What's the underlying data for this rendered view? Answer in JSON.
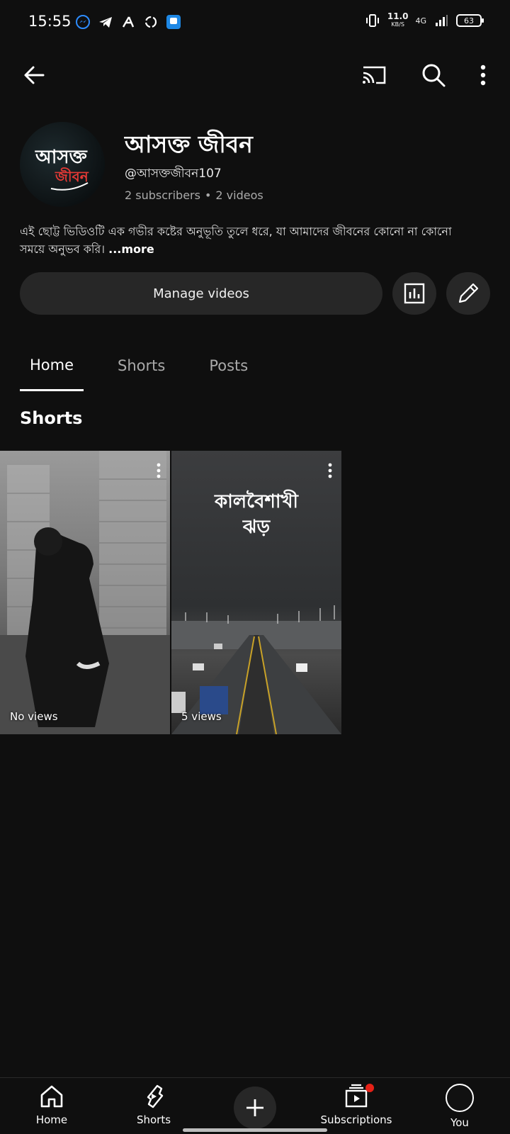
{
  "status_bar": {
    "time": "15:55",
    "speed_value": "11.0",
    "speed_unit": "KB/S",
    "network": "4G",
    "battery": "63"
  },
  "channel": {
    "name": "আসক্ত জীবন",
    "handle": "@আসক্তজীবন107",
    "subscribers": "2 subscribers",
    "videos": "2 videos",
    "description": "এই ছোট্ট ভিডিওটি এক গভীর কষ্টের অনুভূতি তুলে ধরে, যা আমাদের জীবনের কোনো না কোনো সময়ে অনুভব করি।",
    "more_label": "...more",
    "avatar_text_1": "আসক্ত",
    "avatar_text_2": "জীবন"
  },
  "actions": {
    "manage_videos": "Manage videos"
  },
  "tabs": [
    {
      "label": "Home",
      "active": true
    },
    {
      "label": "Shorts",
      "active": false
    },
    {
      "label": "Posts",
      "active": false
    }
  ],
  "section": {
    "title": "Shorts"
  },
  "shorts": [
    {
      "views": "No views",
      "overlay_title": ""
    },
    {
      "views": "5 views",
      "overlay_title_line1": "কালবৈশাখী",
      "overlay_title_line2": "ঝড়"
    }
  ],
  "bottom_nav": {
    "home": "Home",
    "shorts": "Shorts",
    "subscriptions": "Subscriptions",
    "you": "You"
  },
  "colors": {
    "background": "#0f0f0f",
    "surface": "#272727",
    "badge": "#e62117"
  }
}
